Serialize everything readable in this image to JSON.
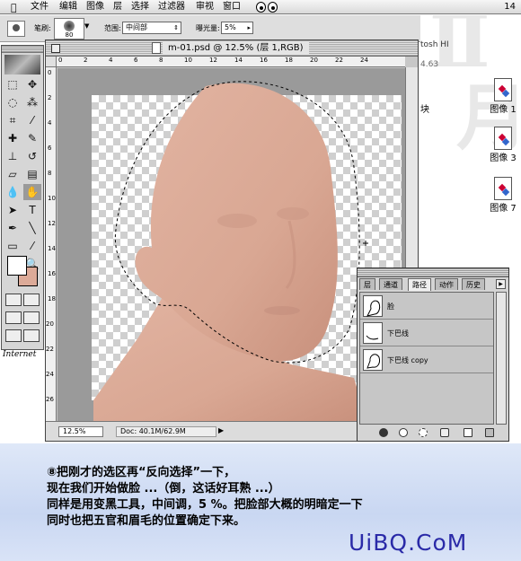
{
  "menubar": {
    "items": [
      "文件",
      "编辑",
      "图像",
      "层",
      "选择",
      "过滤器",
      "审视",
      "窗口"
    ],
    "clock": "14"
  },
  "options": {
    "brush_label": "笔刷:",
    "brush_size": "80",
    "range_label": "范围:",
    "range_value": "中间部",
    "exposure_label": "曝光量:",
    "exposure_value": "5%"
  },
  "background_fragments": {
    "text_tosh": "tosh HI",
    "text_num": "4.63",
    "text_kuai": "块"
  },
  "desktop_icons": [
    "图像 1",
    "图像 3",
    "图像 7"
  ],
  "document": {
    "title": "m-01.psd @ 12.5% (层 1,RGB)",
    "ruler_top": [
      "0",
      "2",
      "4",
      "6",
      "8",
      "10",
      "12",
      "14",
      "16",
      "18",
      "20",
      "22",
      "24"
    ],
    "ruler_left": [
      "0",
      "2",
      "4",
      "6",
      "8",
      "10",
      "12",
      "14",
      "16",
      "18",
      "20",
      "22",
      "24",
      "26"
    ],
    "zoom": "12.5%",
    "doc_info": "Doc: 40.1M/62.9M"
  },
  "paths_palette": {
    "tabs": [
      "层",
      "通道",
      "路径",
      "动作",
      "历史"
    ],
    "active_tab": "路径",
    "paths": [
      {
        "name": "脸"
      },
      {
        "name": "下巴线"
      },
      {
        "name": "下巴线 copy"
      }
    ]
  },
  "internet_label": "Internet",
  "caption": {
    "line1": "⑧把刚才的选区再“反向选择”一下，",
    "line2": "现在我们开始做脸 ...（倒，这话好耳熟 ...）",
    "line3": "同样是用变黑工具，中间调，5 %。把脸部大概的明暗定一下",
    "line4": "同时也把五官和眉毛的位置确定下来。"
  },
  "watermark": "UiBQ.CoM",
  "colors": {
    "skin": "#dcaa98",
    "watermark": "#2a2aa8"
  }
}
